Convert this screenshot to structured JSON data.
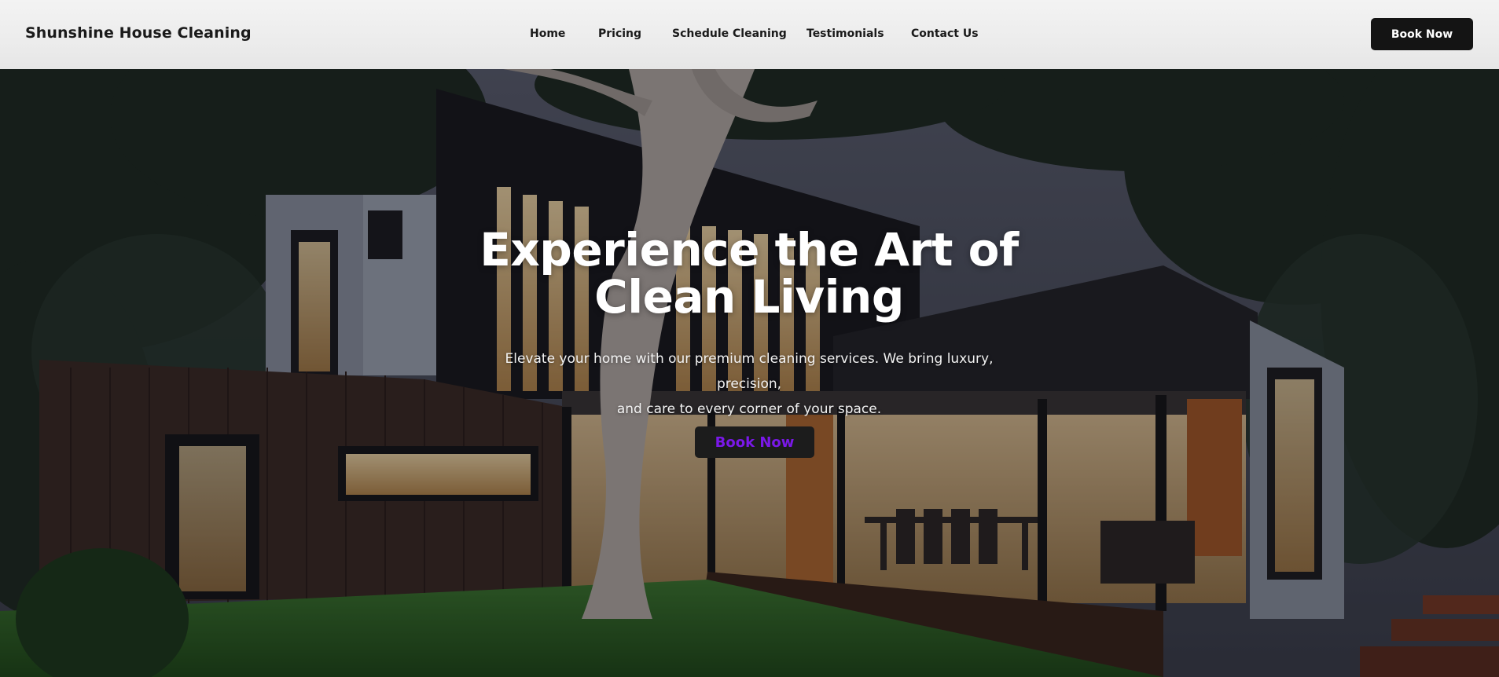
{
  "header": {
    "brand": "Shunshine House Cleaning",
    "nav": [
      {
        "label": "Home"
      },
      {
        "label": "Pricing"
      },
      {
        "label": "Schedule Cleaning"
      },
      {
        "label": "Testimonials"
      },
      {
        "label": "Contact Us"
      }
    ],
    "book_label": "Book Now"
  },
  "hero": {
    "title_line1": "Experience the Art of",
    "title_line2": "Clean Living",
    "subtitle_line1": "Elevate your home with our premium cleaning services. We bring luxury, precision,",
    "subtitle_line2": "and care to every corner of your space.",
    "book_label": "Book Now"
  },
  "colors": {
    "header_bg": "#ececec",
    "button_dark": "#141414",
    "hero_button_text": "#7a18e8"
  }
}
